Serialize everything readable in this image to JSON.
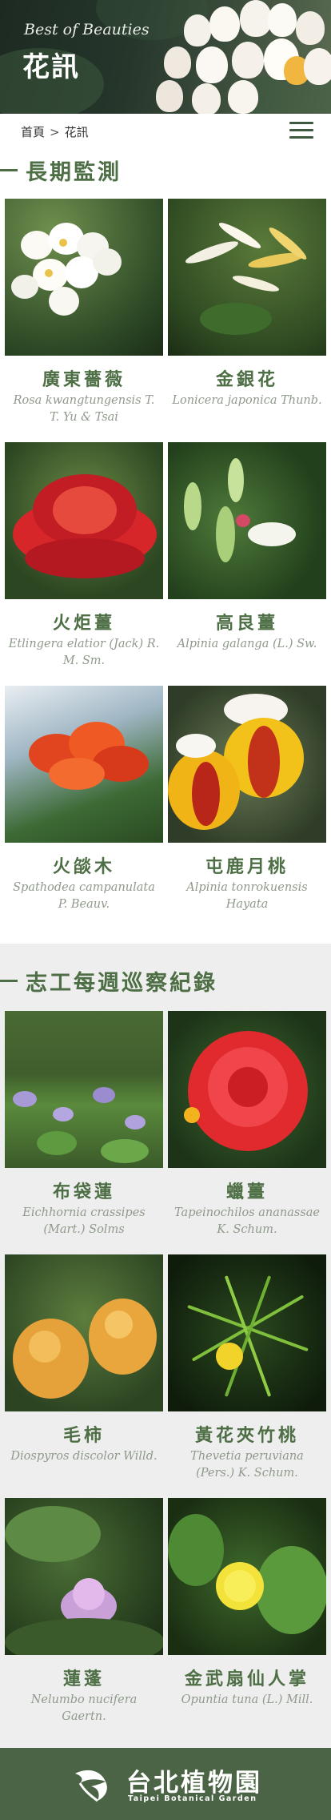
{
  "hero": {
    "subtitle": "Best of Beauties",
    "title": "花訊"
  },
  "breadcrumb": {
    "home": "首頁",
    "separator": ">",
    "current": "花訊"
  },
  "menu": {
    "icon": "hamburger-menu-icon"
  },
  "sections": [
    {
      "title": "長期監測",
      "items": [
        {
          "name": "廣東薔薇",
          "sci": "Rosa kwangtungensis T. T. Yu & Tsai"
        },
        {
          "name": "金銀花",
          "sci": "Lonicera japonica Thunb."
        },
        {
          "name": "火炬薑",
          "sci": "Etlingera elatior (Jack) R. M. Sm."
        },
        {
          "name": "高良薑",
          "sci": "Alpinia galanga (L.) Sw."
        },
        {
          "name": "火燄木",
          "sci": "Spathodea campanulata P. Beauv."
        },
        {
          "name": "屯鹿月桃",
          "sci": "Alpinia tonrokuensis Hayata"
        }
      ]
    },
    {
      "title": "志工每週巡察紀錄",
      "items": [
        {
          "name": "布袋蓮",
          "sci": "Eichhornia crassipes (Mart.) Solms"
        },
        {
          "name": "蠟薑",
          "sci": "Tapeinochilos ananassae K. Schum."
        },
        {
          "name": "毛柿",
          "sci": "Diospyros discolor Willd."
        },
        {
          "name": "黃花夾竹桃",
          "sci": "Thevetia peruviana (Pers.) K. Schum."
        },
        {
          "name": "蓮蓬",
          "sci": "Nelumbo nucifera Gaertn."
        },
        {
          "name": "金武扇仙人掌",
          "sci": "Opuntia tuna (L.) Mill."
        }
      ]
    }
  ],
  "footer": {
    "logo_cn": "台北植物園",
    "logo_en": "Taipei Botanical Garden"
  }
}
